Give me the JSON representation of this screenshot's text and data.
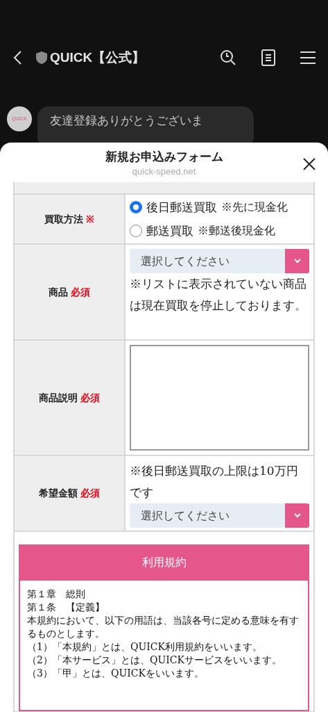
{
  "chat_header": {
    "title": "QUICK【公式】"
  },
  "chat": {
    "avatar_text": "QUICK",
    "message": "友達登録ありがとうございま"
  },
  "sheet": {
    "title": "新規お申込みフォーム",
    "domain": "quick-speed.net"
  },
  "form": {
    "rows": [
      {
        "kind": "radio",
        "label": "買取方法",
        "mark": "※",
        "options": [
          {
            "label": "後日郵送買取",
            "note": "※先に現金化",
            "selected": true
          },
          {
            "label": "郵送買取",
            "note": "※郵送後現金化",
            "selected": false
          }
        ]
      },
      {
        "kind": "select_note",
        "label": "商品",
        "mark": "必須",
        "select": "選択してください",
        "note": "※リストに表示されていない商品は現在買取を停止しております。"
      },
      {
        "kind": "textarea",
        "label": "商品説明",
        "mark": "必須"
      },
      {
        "kind": "note_select",
        "label": "希望金額",
        "mark": "必須",
        "note": "※後日郵送買取の上限は10万円です",
        "select": "選択してください"
      }
    ]
  },
  "terms": {
    "title": "利用規約",
    "lines": [
      "第１章　総則",
      "第１条　【定義】",
      "本規約において、以下の用語は、当該各号に定める意味を有するものとします。",
      "（1）「本規約」とは、QUICK利用規約をいいます。",
      "（2）「本サービス」とは、QUICKサービスをいいます。",
      "（3）「甲」とは、QUICKをいいます。"
    ]
  }
}
